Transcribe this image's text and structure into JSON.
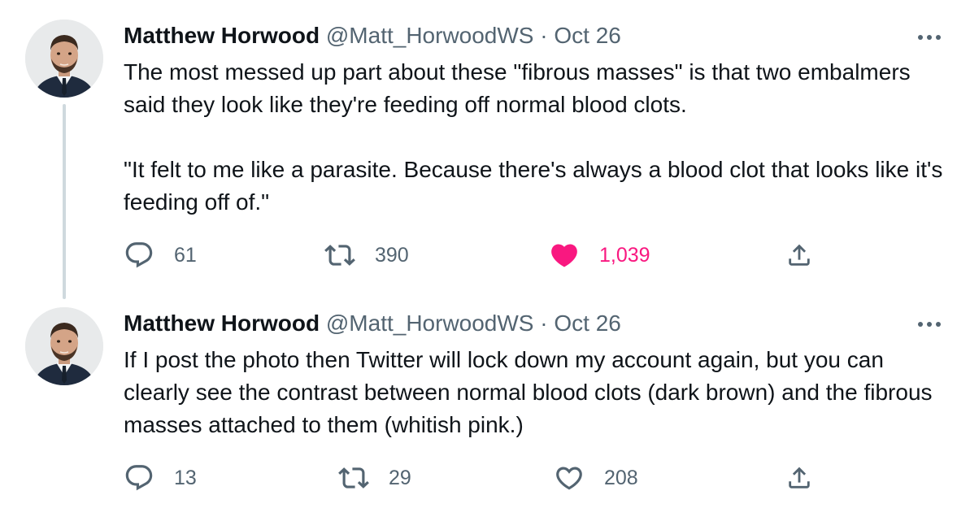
{
  "colors": {
    "text": "#0f1419",
    "secondary": "#536471",
    "like_active": "#f91880",
    "thread_line": "#cfd9de"
  },
  "tweets": [
    {
      "author_name": "Matthew Horwood",
      "handle": "@Matt_HorwoodWS",
      "separator": "·",
      "date": "Oct 26",
      "text": "The most messed up part about these \"fibrous masses\" is that two embalmers said they look like they're feeding off normal blood clots.\n\n\"It felt to me like a parasite. Because there's always a blood clot that looks like it's feeding off of.\"",
      "replies": "61",
      "retweets": "390",
      "likes": "1,039",
      "liked": true,
      "icons": [
        "avatar",
        "more-icon",
        "reply-icon",
        "retweet-icon",
        "heart-filled-icon",
        "share-icon"
      ]
    },
    {
      "author_name": "Matthew Horwood",
      "handle": "@Matt_HorwoodWS",
      "separator": "·",
      "date": "Oct 26",
      "text": "If I post the photo then Twitter will lock down my account again, but you can clearly see the contrast between normal blood clots (dark brown) and the fibrous masses attached to them (whitish pink.)",
      "replies": "13",
      "retweets": "29",
      "likes": "208",
      "liked": false,
      "icons": [
        "avatar",
        "more-icon",
        "reply-icon",
        "retweet-icon",
        "heart-icon",
        "share-icon"
      ]
    }
  ]
}
